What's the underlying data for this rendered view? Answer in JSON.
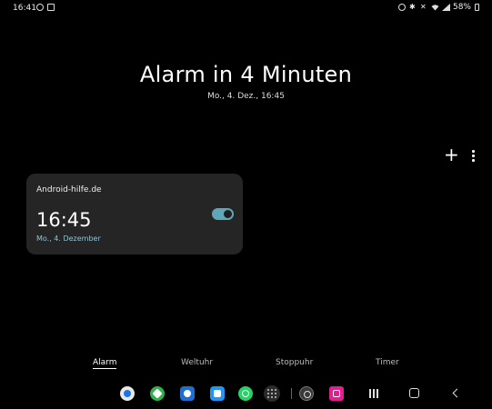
{
  "status_bar": {
    "time": "16:41",
    "battery": "58%",
    "left_icons": [
      "alarm-icon",
      "image-icon"
    ],
    "right_icons": [
      "alarm-icon",
      "bluetooth-icon",
      "mute-icon",
      "wifi-icon",
      "signal-icon"
    ]
  },
  "header": {
    "title": "Alarm in 4 Minuten",
    "date": "Mo., 4. Dez., 16:45"
  },
  "toolbar": {
    "add_label": "+"
  },
  "alarms": [
    {
      "label": "Android-hilfe.de",
      "time": "16:45",
      "day": "Mo., 4. Dezember",
      "enabled": true
    }
  ],
  "tabs": [
    {
      "label": "Alarm",
      "active": true
    },
    {
      "label": "Weltuhr",
      "active": false
    },
    {
      "label": "Stoppuhr",
      "active": false
    },
    {
      "label": "Timer",
      "active": false
    }
  ],
  "taskbar": {
    "apps": [
      {
        "icon": "chrome-icon",
        "color": "#e8e8e8"
      },
      {
        "icon": "feedly-icon",
        "color": "#2fb24c"
      },
      {
        "icon": "camera-icon",
        "color": "#1f6fd1"
      },
      {
        "icon": "files-icon",
        "color": "#2196f3"
      },
      {
        "icon": "whatsapp-icon",
        "color": "#25d366"
      },
      {
        "icon": "compass-icon",
        "color": "#3a3a3a"
      },
      {
        "icon": "tv-icon",
        "color": "#e0208f"
      }
    ]
  },
  "colors": {
    "accent": "#5fa7b8",
    "card_bg": "#252525",
    "background": "#000000"
  }
}
